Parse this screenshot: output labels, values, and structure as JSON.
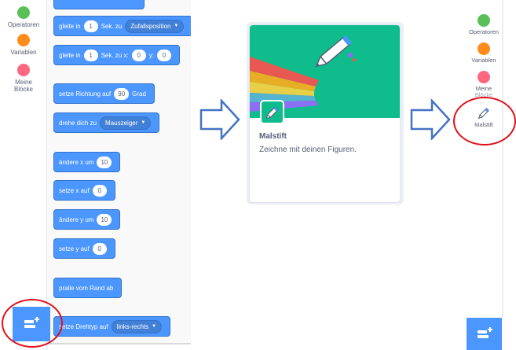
{
  "left_categories": [
    {
      "label": "Operatoren",
      "color": "#59c059"
    },
    {
      "label": "Variablen",
      "color": "#ff8c1a"
    },
    {
      "label_line1": "Meine",
      "label_line2": "Blöcke",
      "color": "#ff6680"
    }
  ],
  "blocks": {
    "glide1": {
      "label": "gleite in",
      "seconds": "1",
      "unit": "Sek. zu",
      "target": "Zufallsposition"
    },
    "glide2": {
      "label": "gleite in",
      "seconds": "1",
      "unit": "Sek. zu x:",
      "x": "0",
      "y_label": "y:",
      "y": "0"
    },
    "point_direction": {
      "label": "setze Richtung auf",
      "value": "90",
      "unit": "Grad"
    },
    "point_towards": {
      "label": "drehe dich zu",
      "target": "Mauszeiger"
    },
    "change_x": {
      "label": "ändere x um",
      "value": "10"
    },
    "set_x": {
      "label": "setze x auf",
      "value": "0"
    },
    "change_y": {
      "label": "ändere y um",
      "value": "10"
    },
    "set_y": {
      "label": "setze y auf",
      "value": "0"
    },
    "bounce": {
      "label": "pralle vom Rand ab"
    },
    "rotation_style": {
      "label": "setze Drehtyp auf",
      "value": "links-rechts"
    }
  },
  "extension_card": {
    "title": "Malstift",
    "description": "Zeichne mit deinen Figuren.",
    "color": "#0fbd8c"
  },
  "right_categories": [
    {
      "label": "Operatoren",
      "color": "#59c059"
    },
    {
      "label": "Variablen",
      "color": "#ff8c1a"
    },
    {
      "label_line1": "Meine",
      "label_line2": "Blöcke",
      "color": "#ff6680"
    },
    {
      "label": "Malstift",
      "icon": "pen-icon"
    }
  ],
  "colors": {
    "motion_block": "#4c97ff",
    "highlight_ring": "#e0101a",
    "arrow_outline": "#4472c4"
  }
}
